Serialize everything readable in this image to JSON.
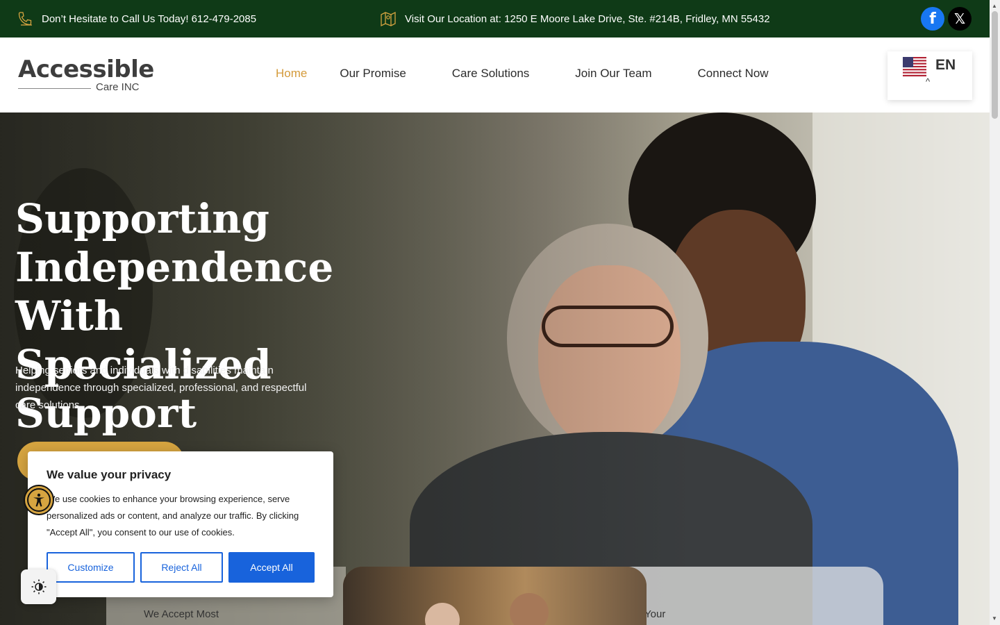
{
  "topbar": {
    "phone_text": "Don’t Hesitate to Call Us Today! 612-479-2085",
    "location_text": "Visit Our Location at: 1250 E Moore Lake Drive, Ste. #214B, Fridley, MN 55432",
    "phone_icon": "phone-icon",
    "location_icon": "map-icon",
    "social": [
      {
        "name": "facebook",
        "glyph": "f"
      },
      {
        "name": "x",
        "glyph": "𝕏"
      }
    ]
  },
  "header": {
    "logo_name": "Accessible",
    "logo_sub": "Care INC",
    "nav": [
      "Home",
      "Our Promise",
      "Care Solutions",
      "Join Our Team",
      "Connect Now"
    ],
    "active_nav": "Home",
    "language": "EN",
    "chevron": "^"
  },
  "hero": {
    "title_lines": [
      "Supporting",
      "Independence With",
      "Specialized Support"
    ],
    "text": "Helping seniors and individuals with disabilities maintain independence through specialized, professional, and respectful care solutions."
  },
  "cards": {
    "left_text": "We Accept Most",
    "right_text": "Your"
  },
  "cookie": {
    "title": "We value your privacy",
    "body": "We use cookies to enhance your browsing experience, serve personalized ads or content, and analyze our traffic. By clicking \"Accept All\", you consent to our use of cookies.",
    "customize": "Customize",
    "reject": "Reject All",
    "accept": "Accept All"
  },
  "colors": {
    "topbar": "#0f3a17",
    "accent": "#d6a440",
    "nav_active": "#d49a3a",
    "cookie_blue": "#1863dc"
  }
}
